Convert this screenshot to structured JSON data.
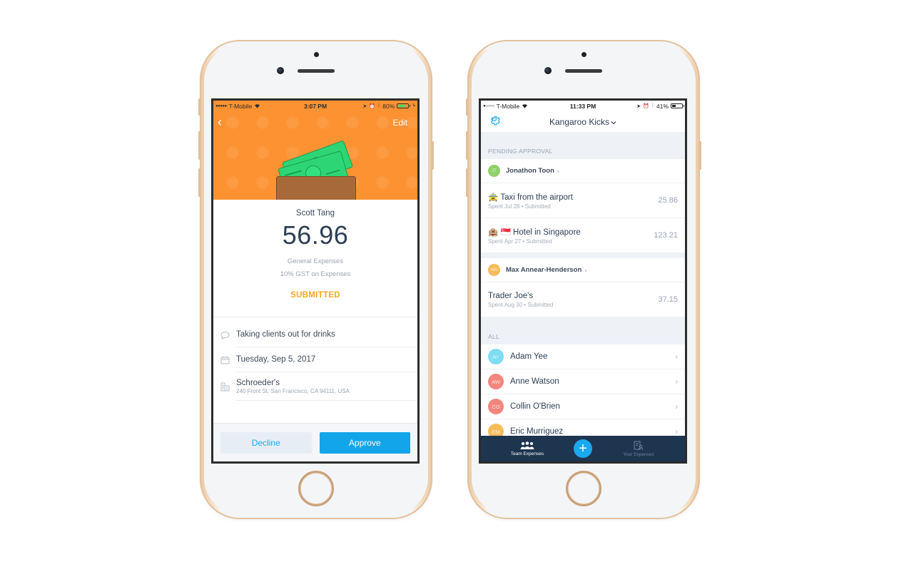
{
  "left_phone": {
    "status_bar": {
      "carrier": "T-Mobile",
      "signal_dots": "●●●●●",
      "time": "3:07 PM",
      "battery_percent": "80%",
      "battery_level": 0.8,
      "battery_color": "#4cd964"
    },
    "header": {
      "back_icon": "chevron-left-icon",
      "back_glyph": "‹",
      "edit_label": "Edit",
      "hero_color": "#fd9232"
    },
    "summary": {
      "submitter": "Scott Tang",
      "amount": "56.96",
      "category": "General Expenses",
      "tax": "10% GST on Expenses",
      "status": "SUBMITTED",
      "status_color": "#f5a623"
    },
    "details": [
      {
        "icon": "comment-icon",
        "text": "Taking clients out for drinks",
        "sub": ""
      },
      {
        "icon": "calendar-icon",
        "text": "Tuesday, Sep 5, 2017",
        "sub": ""
      },
      {
        "icon": "building-icon",
        "text": "Schroeder's",
        "sub": "240 Front St, San Francisco, CA 94111, USA"
      }
    ],
    "actions": {
      "decline_label": "Decline",
      "approve_label": "Approve"
    }
  },
  "right_phone": {
    "status_bar": {
      "carrier": "T-Mobile",
      "signal_dots": "●○○○○",
      "time": "11:33 PM",
      "battery_percent": "41%",
      "battery_level": 0.41,
      "battery_color": "#222222"
    },
    "nav": {
      "settings_icon": "gear-icon",
      "team_name": "Kangaroo Kicks",
      "dropdown_glyph": "⌄"
    },
    "pending": {
      "header": "PENDING APPROVAL",
      "groups": [
        {
          "person": "Jonathon Toon",
          "initials": "JT",
          "avatar_color": "#8fd16a",
          "expenses": [
            {
              "emoji": "🚖",
              "title": "Taxi from the airport",
              "sub": "Spent Jul 28 • Submitted",
              "amount": "25.86"
            },
            {
              "emoji": "🏨 🇸🇬",
              "title": "Hotel in Singapore",
              "sub": "Spent Apr 27 • Submitted",
              "amount": "123.21"
            }
          ]
        },
        {
          "person": "Max Annear-Henderson",
          "initials": "MA",
          "avatar_color": "#f7bc5a",
          "expenses": [
            {
              "emoji": "",
              "title": "Trader Joe's",
              "sub": "Spent Aug 30 • Submitted",
              "amount": "37.15"
            }
          ]
        }
      ]
    },
    "all": {
      "header": "ALL",
      "people": [
        {
          "name": "Adam Yee",
          "initials": "AY",
          "avatar_color": "#7fdcf2"
        },
        {
          "name": "Anne Watson",
          "initials": "AW",
          "avatar_color": "#f4857d"
        },
        {
          "name": "Collin O'Brien",
          "initials": "CO",
          "avatar_color": "#f4857d"
        },
        {
          "name": "Eric Murriguez",
          "initials": "EM",
          "avatar_color": "#f7bc5a"
        }
      ]
    },
    "tabbar": {
      "tabs": [
        {
          "label": "Team Expenses",
          "icon": "team-icon",
          "active": true
        },
        {
          "label": "Your Expenses",
          "icon": "document-user-icon",
          "active": false
        }
      ],
      "add_glyph": "+"
    }
  }
}
